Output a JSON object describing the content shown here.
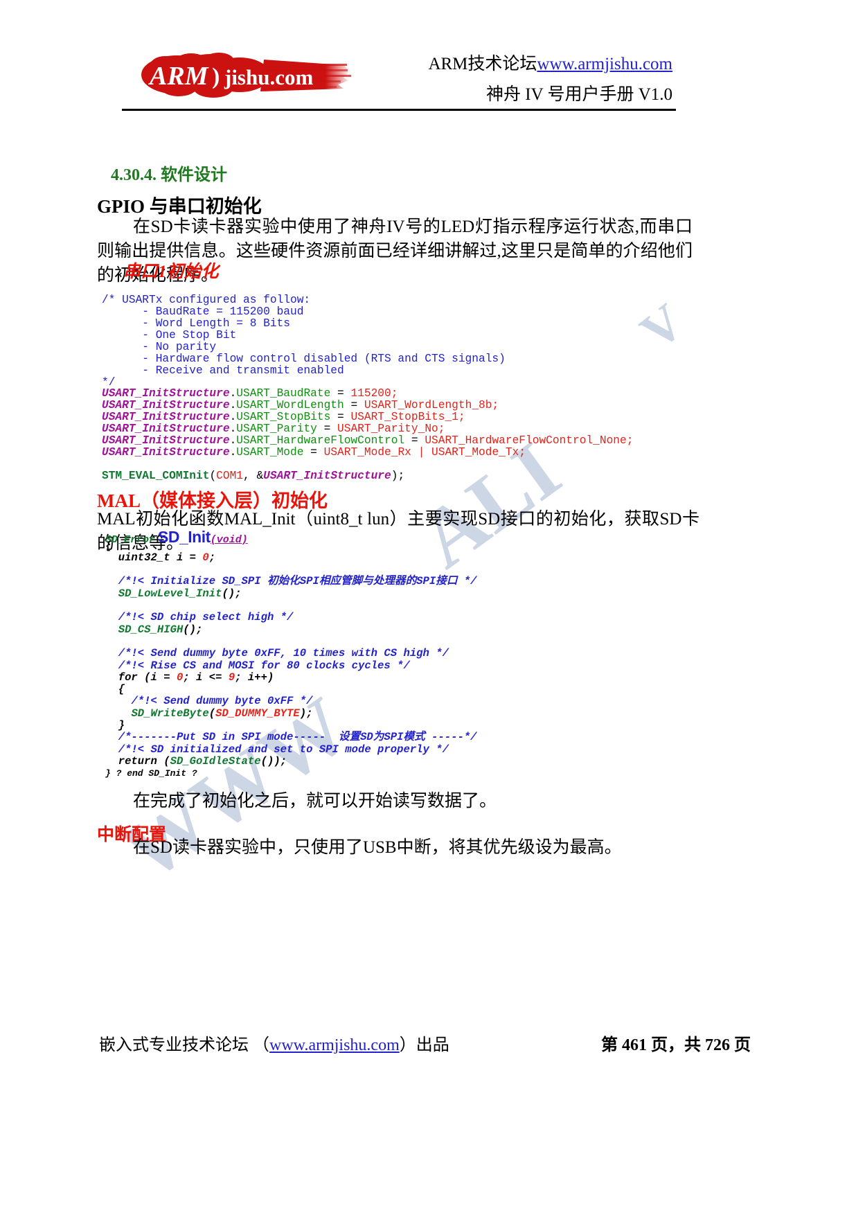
{
  "header": {
    "logo_text_main": "ARM",
    "logo_text_sub": "jishu.com",
    "site_prefix": "ARM技术论坛",
    "site_link": "www.armjishu.com",
    "manual_title": "神舟 IV 号用户手册  V1.0"
  },
  "section": {
    "number_title": "4.30.4. 软件设计",
    "gpio_heading": "GPIO 与串口初始化",
    "paragraph1": "在SD卡读卡器实验中使用了神舟IV号的LED灯指示程序运行状态,而串口则输出提供信息。这些硬件资源前面已经详细讲解过,这里只是简单的介绍他们的初始化程序。",
    "uart_heading": "串口1初始化",
    "mal_heading": "MAL（媒体接入层）初始化",
    "paragraph2": "MAL初始化函数MAL_Init（uint8_t lun）主要实现SD接口的初始化，获取SD卡的信息等。",
    "paragraph3": "在完成了初始化之后，就可以开始读写数据了。",
    "irq_heading": "中断配置",
    "paragraph4": "在SD读卡器实验中，只使用了USB中断，将其优先级设为最高。"
  },
  "code_usart": {
    "comment_lines": [
      "/* USARTx configured as follow:",
      "      - BaudRate = 115200 baud",
      "      - Word Length = 8 Bits",
      "      - One Stop Bit",
      "      - No parity",
      "      - Hardware flow control disabled (RTS and CTS signals)",
      "      - Receive and transmit enabled"
    ],
    "comment_close": "*/",
    "assignments": [
      {
        "struct": "USART_InitStructure",
        "dot": ".",
        "member": "USART_BaudRate",
        "eq": " = ",
        "value": "115200",
        "semi": ";"
      },
      {
        "struct": "USART_InitStructure",
        "dot": ".",
        "member": "USART_WordLength",
        "eq": " = ",
        "value": "USART_WordLength_8b",
        "semi": ";"
      },
      {
        "struct": "USART_InitStructure",
        "dot": ".",
        "member": "USART_StopBits",
        "eq": " = ",
        "value": "USART_StopBits_1",
        "semi": ";"
      },
      {
        "struct": "USART_InitStructure",
        "dot": ".",
        "member": "USART_Parity",
        "eq": " = ",
        "value": "USART_Parity_No",
        "semi": ";"
      },
      {
        "struct": "USART_InitStructure",
        "dot": ".",
        "member": "USART_HardwareFlowControl",
        "eq": " = ",
        "value": "USART_HardwareFlowControl_None",
        "semi": ";"
      },
      {
        "struct": "USART_InitStructure",
        "dot": ".",
        "member": "USART_Mode",
        "eq": " = ",
        "value": "USART_Mode_Rx | USART_Mode_Tx",
        "semi": ";"
      }
    ],
    "call_func": "STM_EVAL_COMInit",
    "call_open": "(",
    "call_arg1": "COM1",
    "call_sep": ", &",
    "call_arg2": "USART_InitStructure",
    "call_close": ");"
  },
  "code_sd": {
    "signature_type": "SD_Error",
    "signature_name": "SD_Init",
    "signature_args": "(void)",
    "lines": [
      "{",
      "  uint32_t i = 0;",
      "",
      "  /*!< Initialize SD_SPI 初始化SPI相应管脚与处理器的SPI接口 */",
      "  SD_LowLevel_Init();",
      "",
      "  /*!< SD chip select high */",
      "  SD_CS_HIGH();",
      "",
      "  /*!< Send dummy byte 0xFF, 10 times with CS high */",
      "  /*!< Rise CS and MOSI for 80 clocks cycles */",
      "  for (i = 0; i <= 9; i++)",
      "  {",
      "    /*!< Send dummy byte 0xFF */",
      "    SD_WriteByte(SD_DUMMY_BYTE);",
      "  }",
      "  /*-------Put SD in SPI mode-----  设置SD为SPI模式 -----*/",
      "  /*!< SD initialized and set to SPI mode properly */",
      "  return (SD_GoIdleState());",
      "} ? end SD_Init ?"
    ]
  },
  "watermark": {
    "text1": "V",
    "text2": "ALI",
    "text3": "WWW"
  },
  "footer": {
    "left_prefix": "嵌入式专业技术论坛 （",
    "left_link": "www.armjishu.com",
    "left_suffix": "）出品",
    "page_info": "第 461 页，共 726 页"
  },
  "colors": {
    "green_heading": "#1f7a1f",
    "red_heading": "#e8140a",
    "link_blue": "#2222cc",
    "code_comment": "#2222cc",
    "code_struct": "#a0129a",
    "code_member": "#0f8f0f",
    "code_value": "#e2231a",
    "logo_red": "#cc1111",
    "watermark": "#aebdd6"
  }
}
